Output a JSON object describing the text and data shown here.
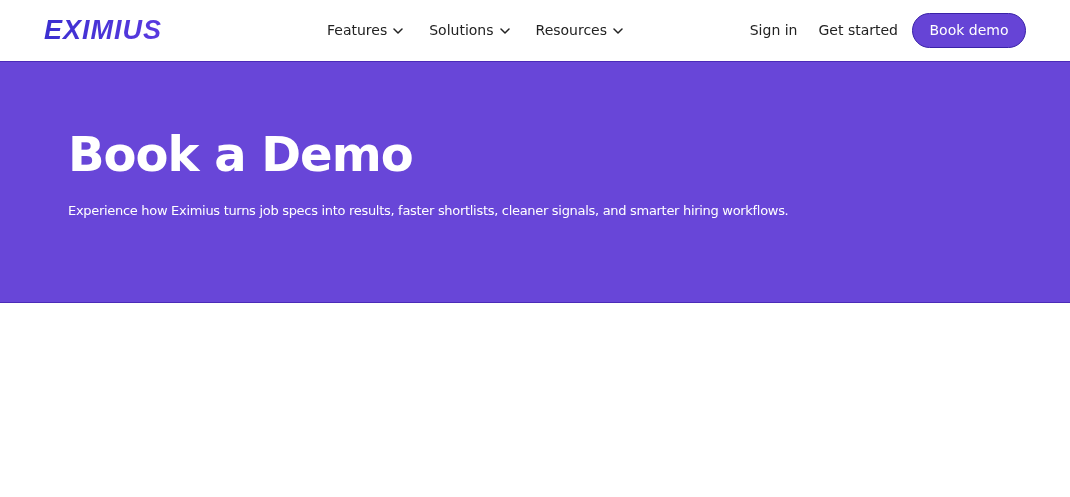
{
  "header": {
    "logo": "EXIMIUS",
    "nav": [
      {
        "label": "Features"
      },
      {
        "label": "Solutions"
      },
      {
        "label": "Resources"
      }
    ],
    "sign_in": "Sign in",
    "get_started": "Get started",
    "book_demo": "Book demo"
  },
  "hero": {
    "title": "Book a Demo",
    "subtitle": "Experience how Eximius turns job specs into results, faster shortlists, cleaner signals, and smarter hiring workflows."
  }
}
